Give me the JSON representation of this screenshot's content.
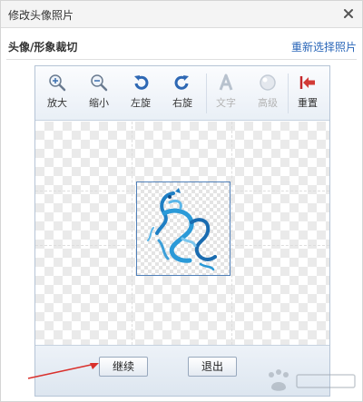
{
  "dialog": {
    "title": "修改头像照片",
    "subheader_title": "头像/形象裁切",
    "reselect_link": "重新选择照片"
  },
  "toolbar": {
    "tools": [
      {
        "label": "放大",
        "icon": "zoom-in-icon",
        "enabled": true
      },
      {
        "label": "缩小",
        "icon": "zoom-out-icon",
        "enabled": true
      },
      {
        "label": "左旋",
        "icon": "rotate-left-icon",
        "enabled": true
      },
      {
        "label": "右旋",
        "icon": "rotate-right-icon",
        "enabled": true
      },
      {
        "label": "文字",
        "icon": "text-icon",
        "enabled": false
      },
      {
        "label": "高级",
        "icon": "advanced-icon",
        "enabled": false
      },
      {
        "label": "重置",
        "icon": "reset-icon",
        "enabled": true
      }
    ]
  },
  "footer": {
    "continue_label": "继续",
    "exit_label": "退出"
  },
  "colors": {
    "accent": "#2a66b8",
    "annotation_arrow": "#d9302c"
  }
}
